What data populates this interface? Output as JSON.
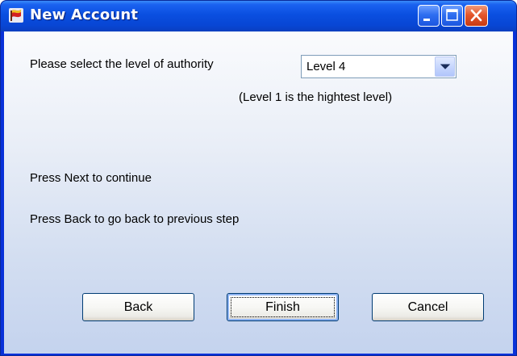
{
  "window": {
    "title": "New Account",
    "icon": "app-flag-icon"
  },
  "titlebar_buttons": {
    "minimize": "minimize-icon",
    "maximize": "maximize-icon",
    "close": "close-icon"
  },
  "authority": {
    "prompt": "Please select the level of authority",
    "selected_value": "Level 4",
    "hint": "(Level 1 is the hightest level)"
  },
  "instructions": {
    "next_text": "Press Next to continue",
    "back_text": "Press Back to go back to previous step"
  },
  "buttons": {
    "back": "Back",
    "finish": "Finish",
    "cancel": "Cancel"
  },
  "colors": {
    "titlebar": "#0a4fe0",
    "close_button": "#e4572c",
    "client_background": "#d3def1"
  }
}
